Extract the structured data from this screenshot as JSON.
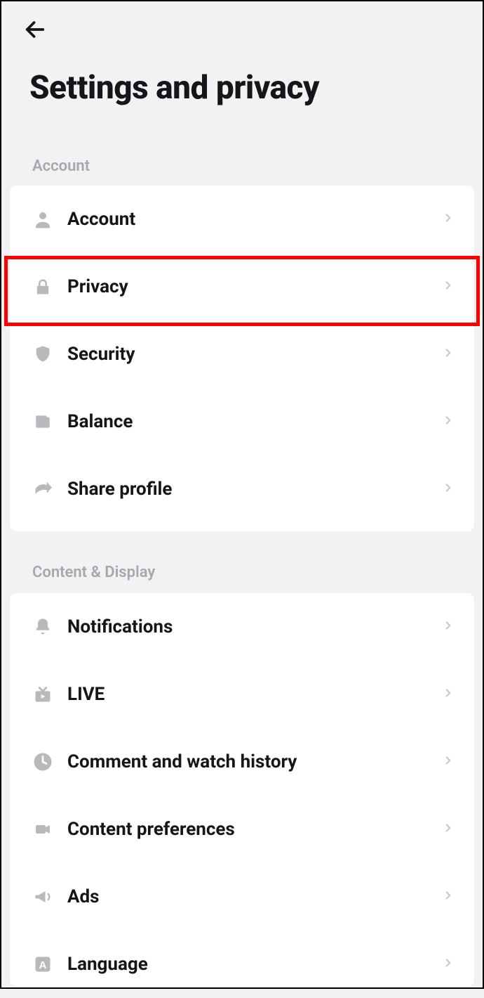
{
  "page": {
    "title": "Settings and privacy"
  },
  "sections": {
    "account": {
      "header": "Account",
      "rows": [
        {
          "label": "Account"
        },
        {
          "label": "Privacy"
        },
        {
          "label": "Security"
        },
        {
          "label": "Balance"
        },
        {
          "label": "Share profile"
        }
      ]
    },
    "content": {
      "header": "Content & Display",
      "rows": [
        {
          "label": "Notifications"
        },
        {
          "label": "LIVE"
        },
        {
          "label": "Comment and watch history"
        },
        {
          "label": "Content preferences"
        },
        {
          "label": "Ads"
        },
        {
          "label": "Language"
        }
      ]
    }
  }
}
